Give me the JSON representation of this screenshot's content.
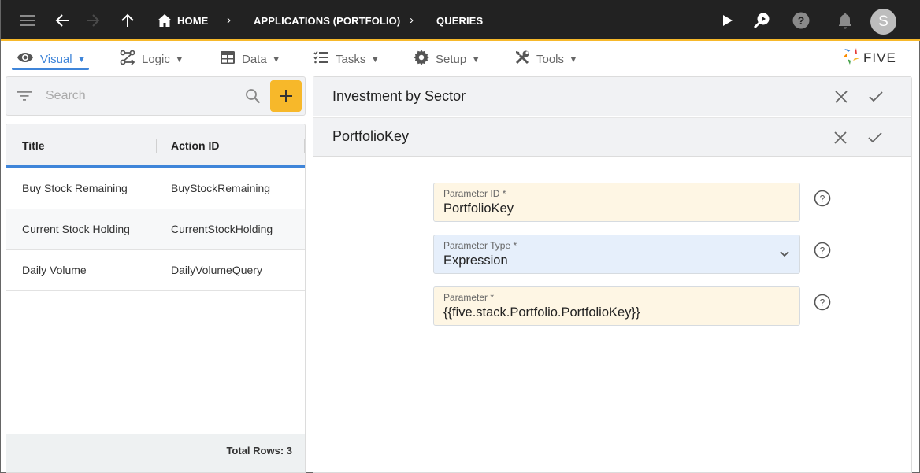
{
  "topbar": {
    "breadcrumbs": [
      {
        "label": "HOME",
        "icon": "home-icon"
      },
      {
        "label": "APPLICATIONS (PORTFOLIO)"
      },
      {
        "label": "QUERIES"
      }
    ],
    "avatar_initial": "S",
    "icons": [
      "menu-icon",
      "back-arrow-icon",
      "forward-arrow-icon",
      "up-arrow-icon",
      "play-icon",
      "run-search-icon",
      "help-icon",
      "bell-icon"
    ]
  },
  "menubar": {
    "items": [
      {
        "label": "Visual",
        "icon": "eye-icon",
        "active": true
      },
      {
        "label": "Logic",
        "icon": "logic-icon"
      },
      {
        "label": "Data",
        "icon": "table-icon"
      },
      {
        "label": "Tasks",
        "icon": "checklist-icon"
      },
      {
        "label": "Setup",
        "icon": "gear-icon"
      },
      {
        "label": "Tools",
        "icon": "tools-icon"
      }
    ],
    "dropdown_glyph": "▼",
    "logo_text": "FIVE"
  },
  "search": {
    "placeholder": "Search"
  },
  "list": {
    "columns": [
      "Title",
      "Action ID"
    ],
    "rows": [
      {
        "title": "Buy Stock Remaining",
        "action_id": "BuyStockRemaining"
      },
      {
        "title": "Current Stock Holding",
        "action_id": "CurrentStockHolding"
      },
      {
        "title": "Daily Volume",
        "action_id": "DailyVolumeQuery"
      }
    ],
    "footer": "Total Rows: 3"
  },
  "detail": {
    "parent_title": "Investment by Sector",
    "child_title": "PortfolioKey",
    "fields": [
      {
        "label": "Parameter ID *",
        "value": "PortfolioKey",
        "type": "text"
      },
      {
        "label": "Parameter Type *",
        "value": "Expression",
        "type": "select"
      },
      {
        "label": "Parameter *",
        "value": "{{five.stack.Portfolio.PortfolioKey}}",
        "type": "text"
      }
    ]
  },
  "colors": {
    "topbar_bg": "#222222",
    "accent_yellow": "#f7b82a",
    "accent_blue": "#3f85d9",
    "field_yellow": "#fef6e4",
    "field_blue": "#e6effb"
  }
}
